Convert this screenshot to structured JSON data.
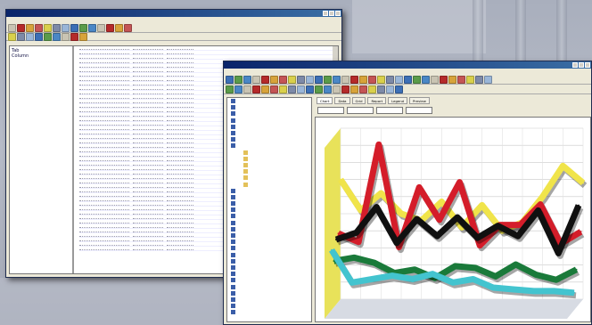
{
  "colors": {
    "titlebar": "#0a246a",
    "chart_yellow": "#f0e44a",
    "chart_red": "#d41d2a",
    "chart_black": "#101010",
    "chart_green": "#1a7a3a",
    "chart_cyan": "#43c4cf",
    "chart_wall": "#e8e25a"
  },
  "window_back": {
    "tree_items": [
      "Tab",
      "Column"
    ],
    "row_count": 46
  },
  "window_front": {
    "tabs": [
      "Chart",
      "Data",
      "Grid",
      "Report",
      "Legend",
      "Preview"
    ],
    "fields": [
      "",
      "",
      "",
      ""
    ],
    "tree_nodes": [
      {
        "label": "",
        "icon": "doc-icon"
      },
      {
        "label": "",
        "icon": "doc-icon"
      },
      {
        "label": "",
        "icon": "doc-icon"
      },
      {
        "label": "",
        "icon": "doc-icon"
      },
      {
        "label": "",
        "icon": "doc-icon"
      },
      {
        "label": "",
        "icon": "doc-icon"
      },
      {
        "label": "",
        "icon": "doc-icon"
      },
      {
        "label": "",
        "icon": "doc-icon"
      },
      {
        "label": "",
        "icon": "folder-icon"
      },
      {
        "label": "",
        "icon": "folder-icon",
        "selected": true
      },
      {
        "label": "",
        "icon": "folder-icon"
      },
      {
        "label": "",
        "icon": "folder-icon"
      },
      {
        "label": "",
        "icon": "folder-icon"
      },
      {
        "label": "",
        "icon": "folder-icon"
      },
      {
        "label": "",
        "icon": "doc-icon"
      },
      {
        "label": "",
        "icon": "doc-icon"
      },
      {
        "label": "",
        "icon": "doc-icon"
      },
      {
        "label": "",
        "icon": "doc-icon"
      },
      {
        "label": "",
        "icon": "doc-icon"
      },
      {
        "label": "",
        "icon": "doc-icon"
      },
      {
        "label": "",
        "icon": "doc-icon"
      },
      {
        "label": "",
        "icon": "doc-icon"
      },
      {
        "label": "",
        "icon": "doc-icon"
      },
      {
        "label": "",
        "icon": "doc-icon"
      },
      {
        "label": "",
        "icon": "doc-icon"
      },
      {
        "label": "",
        "icon": "doc-icon"
      },
      {
        "label": "",
        "icon": "doc-icon"
      },
      {
        "label": "",
        "icon": "doc-icon"
      },
      {
        "label": "",
        "icon": "doc-icon"
      },
      {
        "label": "",
        "icon": "doc-icon"
      },
      {
        "label": "",
        "icon": "doc-icon"
      },
      {
        "label": "",
        "icon": "doc-icon"
      },
      {
        "label": "",
        "icon": "doc-icon"
      },
      {
        "label": "",
        "icon": "doc-icon"
      }
    ]
  },
  "chart_data": {
    "type": "line",
    "style": "3d-ribbon",
    "title": "",
    "xlabel": "",
    "ylabel": "",
    "grid": true,
    "legend": "none",
    "x": [
      1,
      2,
      3,
      4,
      5,
      6,
      7,
      8,
      9,
      10,
      11,
      12,
      13
    ],
    "ylim": [
      0,
      100
    ],
    "series": [
      {
        "color": "#f0e44a",
        "values": [
          70,
          52,
          62,
          50,
          46,
          57,
          42,
          55,
          40,
          45,
          60,
          78,
          68
        ]
      },
      {
        "color": "#d41d2a",
        "values": [
          40,
          35,
          92,
          32,
          67,
          48,
          70,
          33,
          45,
          45,
          57,
          34,
          41
        ]
      },
      {
        "color": "#101010",
        "values": [
          38,
          42,
          57,
          36,
          50,
          40,
          51,
          39,
          46,
          40,
          55,
          30,
          58
        ]
      },
      {
        "color": "#1a7a3a",
        "values": [
          27,
          29,
          26,
          20,
          22,
          17,
          24,
          23,
          18,
          25,
          19,
          16,
          22
        ]
      },
      {
        "color": "#43c4cf",
        "values": [
          35,
          16,
          18,
          20,
          18,
          21,
          16,
          18,
          13,
          12,
          11,
          11,
          10
        ]
      }
    ]
  }
}
